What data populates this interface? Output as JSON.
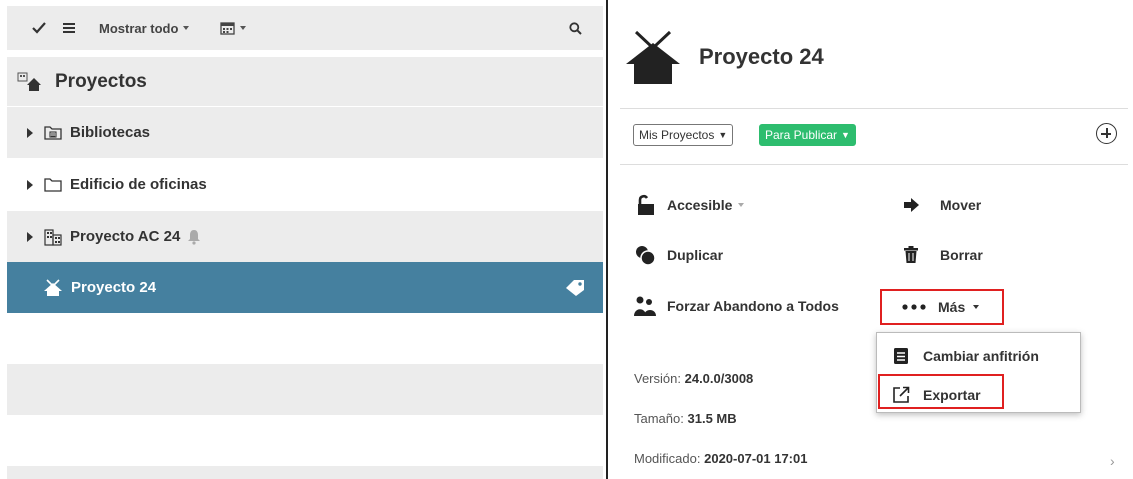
{
  "toolbar": {
    "filter_label": "Mostrar todo"
  },
  "tree": {
    "title": "Proyectos",
    "items": [
      {
        "label": "Bibliotecas",
        "icon": "library-folder-icon"
      },
      {
        "label": "Edificio de oficinas",
        "icon": "folder-icon"
      },
      {
        "label": "Proyecto AC 24",
        "icon": "building-icon",
        "badge": "bell-icon"
      },
      {
        "label": "Proyecto 24",
        "icon": "project-house-icon",
        "badge": "tag-icon",
        "selected": true
      }
    ]
  },
  "detail": {
    "title": "Proyecto 24",
    "project_filter": "Mis Proyectos",
    "status": "Para Publicar",
    "actions": {
      "access": "Accesible",
      "move": "Mover",
      "duplicate": "Duplicar",
      "delete": "Borrar",
      "force_leave": "Forzar Abandono a Todos",
      "more": "Más"
    },
    "more_menu": {
      "change_host": "Cambiar anfitrión",
      "export": "Exportar"
    },
    "info": {
      "version_label": "Versión:",
      "version_value": "24.0.0/3008",
      "size_label": "Tamaño:",
      "size_value": "31.5 MB",
      "modified_label": "Modificado:",
      "modified_value": "2020-07-01 17:01"
    }
  },
  "colors": {
    "selection": "#45809f",
    "status_green": "#2dbd6e",
    "highlight_red": "#e02020"
  }
}
